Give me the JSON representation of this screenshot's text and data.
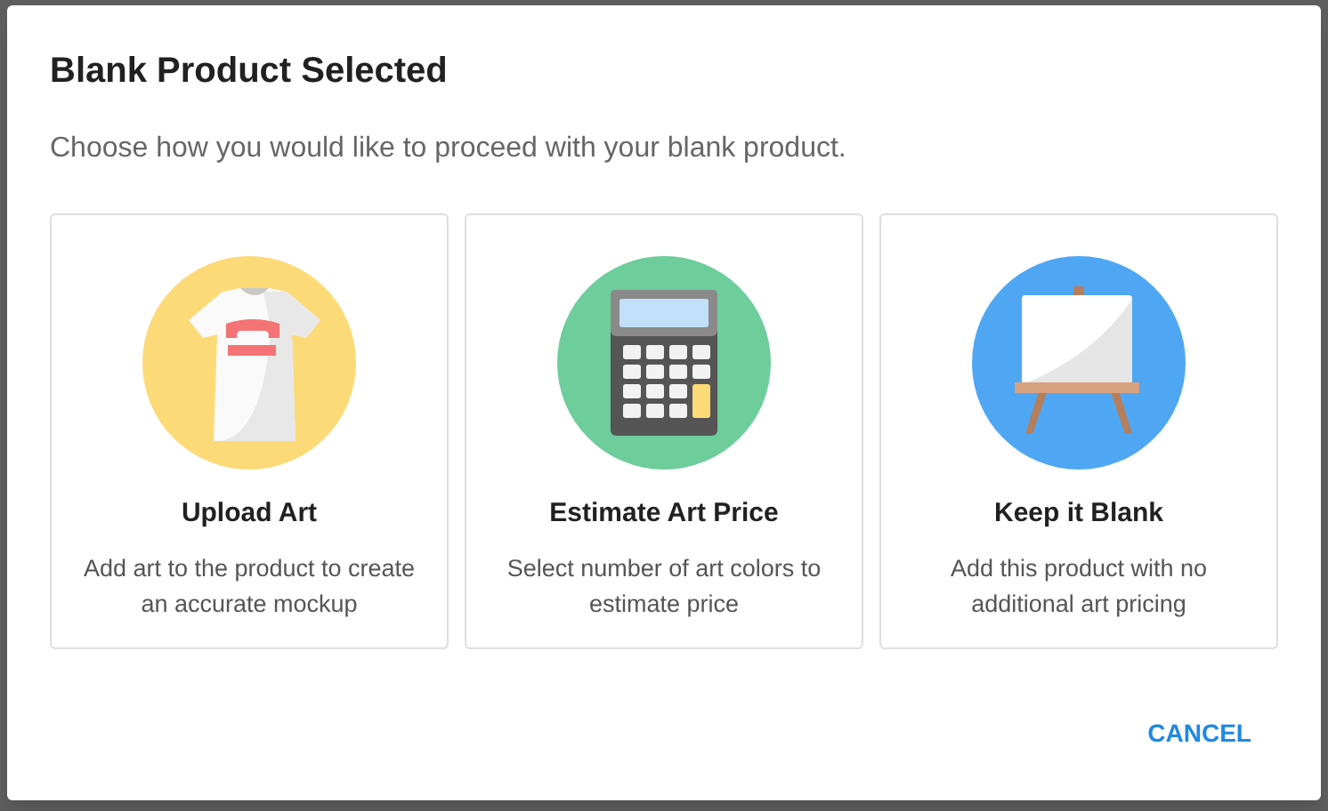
{
  "dialog": {
    "title": "Blank Product Selected",
    "description": "Choose how you would like to proceed with your blank product.",
    "options": [
      {
        "kind": "shirt",
        "title": "Upload Art",
        "description": "Add art to the product to create an accurate mockup"
      },
      {
        "kind": "calculator",
        "title": "Estimate Art Price",
        "description": "Select number of art colors to estimate price"
      },
      {
        "kind": "easel",
        "title": "Keep it Blank",
        "description": "Add this product with no additional art pricing"
      }
    ],
    "buttons": [
      "CANCEL"
    ]
  }
}
